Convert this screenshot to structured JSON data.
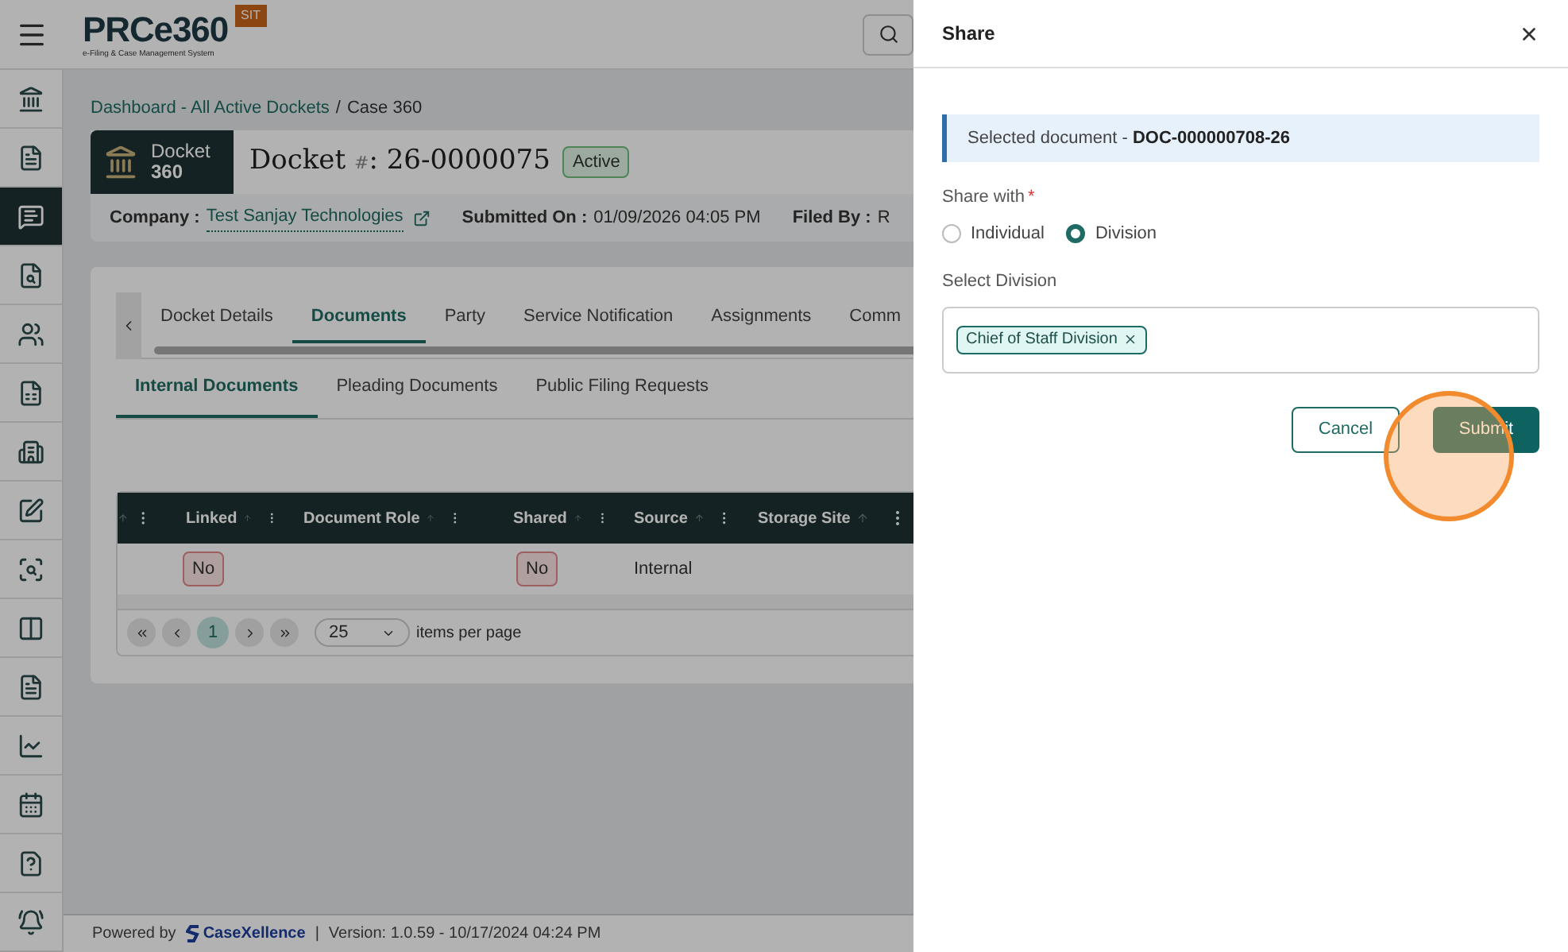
{
  "header": {
    "logo_text": "PRCe360",
    "logo_tagline": "e-Filing & Case Management System",
    "env_badge": "SIT"
  },
  "sidebar": {
    "items": [
      {
        "selected": false
      },
      {
        "selected": false
      },
      {
        "selected": true
      },
      {
        "selected": false
      },
      {
        "selected": false
      },
      {
        "selected": false
      },
      {
        "selected": false
      },
      {
        "selected": false
      },
      {
        "selected": false
      },
      {
        "selected": false
      },
      {
        "selected": false
      },
      {
        "selected": false
      },
      {
        "selected": false
      },
      {
        "selected": false
      },
      {
        "selected": false
      }
    ]
  },
  "breadcrumb": {
    "items": [
      {
        "label": "Dashboard - All Active Dockets",
        "link": true
      },
      {
        "label": "Case 360",
        "link": false
      }
    ],
    "separator": "/"
  },
  "docket": {
    "badge_line1": "Docket",
    "badge_line2": "360",
    "title": "Docket",
    "title_mark": "#",
    "title_number": ": 26-0000075",
    "status": "Active"
  },
  "info": [
    {
      "label": "Company :",
      "value": "Test Sanjay Technologies",
      "link": true
    },
    {
      "label": "Submitted On :",
      "value": "01/09/2026 04:05 PM",
      "link": false
    },
    {
      "label": "Filed By :",
      "value": "R",
      "link": false
    }
  ],
  "tabs": [
    {
      "label": "Docket Details",
      "selected": false
    },
    {
      "label": "Documents",
      "selected": true
    },
    {
      "label": "Party",
      "selected": false
    },
    {
      "label": "Service Notification",
      "selected": false
    },
    {
      "label": "Assignments",
      "selected": false
    },
    {
      "label": "Comm",
      "selected": false
    }
  ],
  "subtabs": [
    {
      "label": "Internal Documents",
      "selected": true
    },
    {
      "label": "Pleading Documents",
      "selected": false
    },
    {
      "label": "Public Filing Requests",
      "selected": false
    }
  ],
  "table": {
    "columns": [
      "Linked",
      "Document Role",
      "Shared",
      "Source",
      "Storage Site"
    ],
    "rows": [
      {
        "cells": [
          {
            "kind": "badge",
            "text": "No"
          },
          {
            "kind": "empty"
          },
          {
            "kind": "badge",
            "text": "No"
          },
          {
            "kind": "text",
            "text": "Internal"
          },
          {
            "kind": "empty"
          }
        ]
      }
    ]
  },
  "pagination": {
    "pages": [
      {
        "label": "1",
        "selected": true
      }
    ],
    "page_size": "25",
    "page_size_label": "items per page"
  },
  "footer": {
    "powered_by": "Powered by",
    "brand": "CaseXellence",
    "separator": "|",
    "version": "Version: 1.0.59 - 10/17/2024 04:24 PM"
  },
  "dialog": {
    "title": "Share",
    "selected_document_label": "Selected document - ",
    "selected_document": "DOC-000000708-26",
    "share_with_label": "Share with",
    "required_marker": "*",
    "options": [
      {
        "label": "Individual",
        "selected": false
      },
      {
        "label": "Division",
        "selected": true
      }
    ],
    "division_label": "Select Division",
    "chips": [
      {
        "label": "Chief of Staff Division"
      }
    ],
    "cancel": "Cancel",
    "submit": "Submit"
  }
}
